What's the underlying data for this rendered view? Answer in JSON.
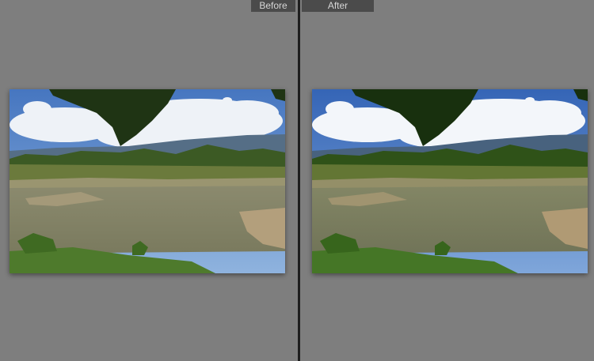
{
  "before_view": {
    "label": "Before",
    "photo_name": "river-landscape-photo-before"
  },
  "after_view": {
    "label": "After",
    "photo_name": "river-landscape-photo-after"
  },
  "colors": {
    "background": "#7e7e7e",
    "divider": "#1e1e1e",
    "label_bg": "#4b4b4b",
    "label_text": "#d6d6d6",
    "sky_before": "#4f7fc0",
    "sky_after": "#3f6fb8"
  }
}
